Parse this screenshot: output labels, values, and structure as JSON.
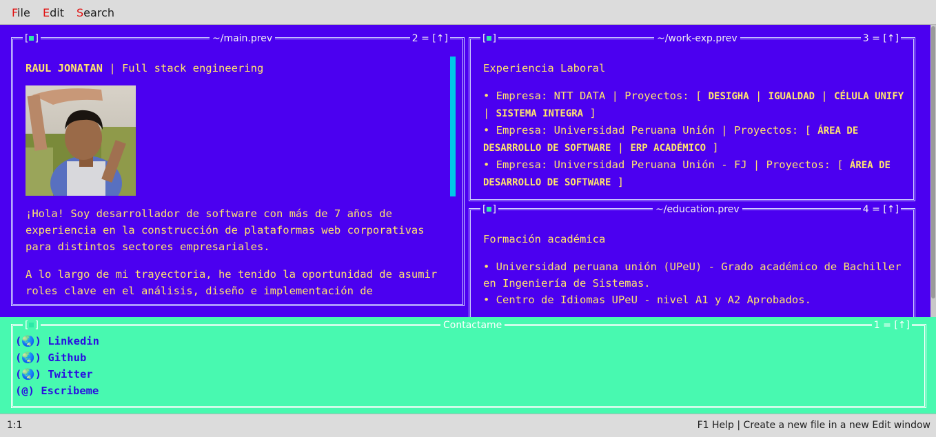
{
  "menu": {
    "file": {
      "hot": "F",
      "rest": "ile"
    },
    "edit": {
      "hot": "E",
      "rest": "dit"
    },
    "search": {
      "hot": "S",
      "rest": "earch"
    }
  },
  "main_window": {
    "title": "~/main.prev",
    "number": "2 = [↑]",
    "name": "RAUL JONATAN",
    "role": " | Full stack engineering",
    "intro": "¡Hola! Soy desarrollador de software con más de 7 años de experiencia en la construcción de plataformas web corporativas para distintos sectores empresariales.",
    "trajectory": "A lo largo de mi trayectoria, he tenido la oportunidad de asumir roles clave en el análisis, diseño e implementación de"
  },
  "work_window": {
    "title": "~/work-exp.prev",
    "number": "3 = [↑]",
    "heading": "Experiencia Laboral",
    "items": [
      {
        "prefix": "• Empresa: NTT DATA | Proyectos: [ ",
        "projects": [
          "DESIGHA",
          "IGUALDAD",
          "CÉLULA UNIFY",
          "SISTEMA INTEGRA"
        ]
      },
      {
        "prefix": "• Empresa: Universidad Peruana Unión | Proyectos: [ ",
        "projects": [
          "ÁREA DE DESARROLLO DE SOFTWARE",
          "ERP ACADÉMICO"
        ]
      },
      {
        "prefix": "• Empresa: Universidad Peruana Unión - FJ | Proyectos: [ ",
        "projects": [
          "ÁREA DE DESARROLLO DE SOFTWARE"
        ]
      }
    ]
  },
  "education_window": {
    "title": "~/education.prev",
    "number": "4 = [↑]",
    "heading": "Formación académica",
    "items": [
      "• Universidad peruana unión (UPeU) - Grado académico de Bachiller en Ingeniería de Sistemas.",
      "• Centro de Idiomas UPeU - nivel A1 y A2 Aprobados."
    ]
  },
  "contact_window": {
    "title": "Contactame",
    "number": "1 = [↑]",
    "links": [
      {
        "icon": "(🌏)",
        "label": "Linkedin"
      },
      {
        "icon": "(🌏)",
        "label": "Github"
      },
      {
        "icon": "(🌏)",
        "label": "Twitter"
      },
      {
        "icon": "(@)",
        "label": "Escribeme"
      }
    ]
  },
  "status": {
    "position": "1:1",
    "help": "F1 Help | Create a new file in a new Edit window"
  },
  "colors": {
    "desktop": "#4b00f0",
    "text": "#ffe36e",
    "contact_bg": "#48f9b0",
    "link": "#2a10e0"
  }
}
